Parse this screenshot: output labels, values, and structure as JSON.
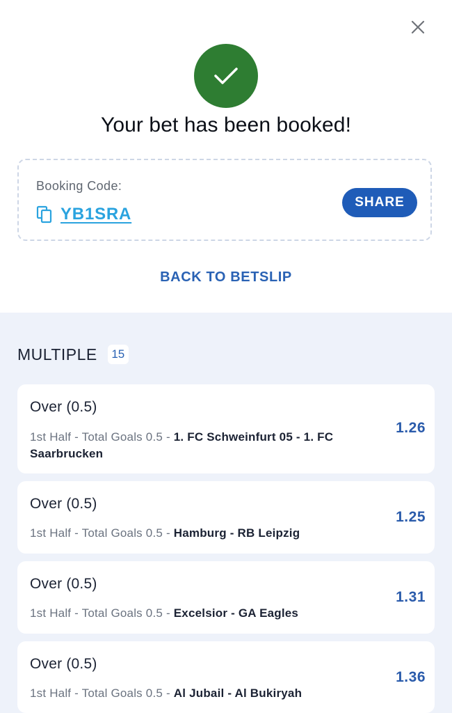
{
  "header": {
    "close_icon": "close-icon",
    "success_icon": "checkmark-icon",
    "title": "Your bet has been booked!"
  },
  "booking": {
    "label": "Booking Code:",
    "copy_icon": "copy-icon",
    "code": "YB1SRA",
    "share_label": "SHARE"
  },
  "back_link": "BACK TO BETSLIP",
  "betslip": {
    "type_label": "MULTIPLE",
    "count": "15",
    "selections": [
      {
        "pick": "Over (0.5)",
        "market": "1st Half - Total Goals 0.5 -",
        "match": "1. FC Schweinfurt 05 - 1. FC Saarbrucken",
        "odds": "1.26"
      },
      {
        "pick": "Over (0.5)",
        "market": "1st Half - Total Goals 0.5 -",
        "match": "Hamburg - RB Leipzig",
        "odds": "1.25"
      },
      {
        "pick": "Over (0.5)",
        "market": "1st Half - Total Goals 0.5 -",
        "match": "Excelsior - GA Eagles",
        "odds": "1.31"
      },
      {
        "pick": "Over (0.5)",
        "market": "1st Half - Total Goals 0.5 -",
        "match": "Al Jubail - Al Bukiryah",
        "odds": "1.36"
      }
    ]
  },
  "colors": {
    "success_green": "#2e7d32",
    "primary_blue": "#1f5cb8",
    "code_link": "#2aa3df",
    "odds_blue": "#2a5bab",
    "list_background": "#eef2fa"
  }
}
